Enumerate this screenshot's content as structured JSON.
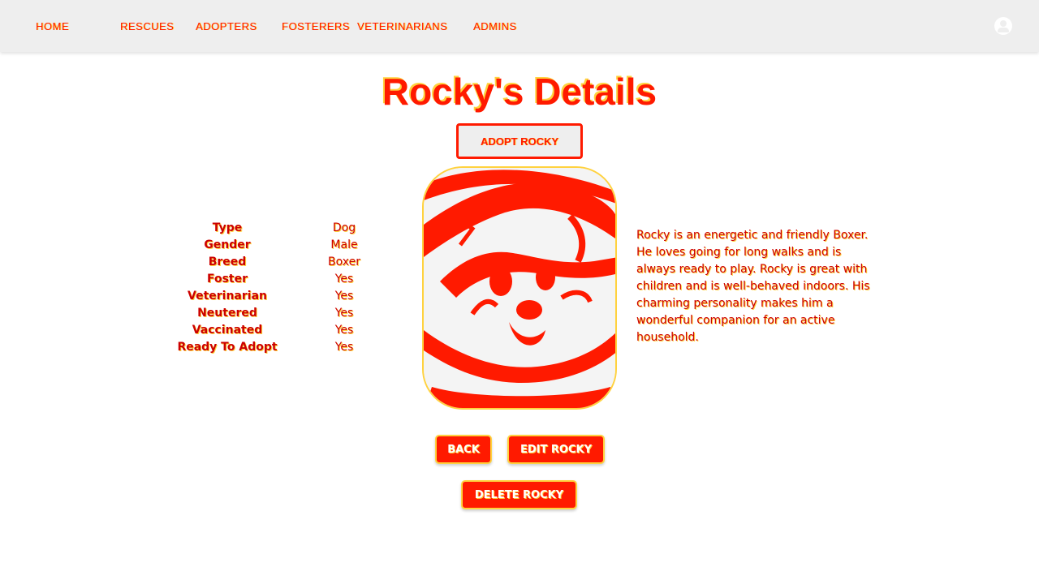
{
  "nav": {
    "home": "HOME",
    "rescues": "RESCUES",
    "adopters": "ADOPTERS",
    "fosterers": "FOSTERERS",
    "vets": "VETERINARIANS",
    "admins": "ADMINS",
    "user_icon": "account-circle-icon"
  },
  "page": {
    "title": "Rocky's Details",
    "adopt_button": "ADOPT ROCKY"
  },
  "details": [
    {
      "label": "Type",
      "value": "Dog"
    },
    {
      "label": "Gender",
      "value": "Male"
    },
    {
      "label": "Breed",
      "value": "Boxer"
    },
    {
      "label": "Foster",
      "value": "Yes"
    },
    {
      "label": "Veterinarian",
      "value": "Yes"
    },
    {
      "label": "Neutered",
      "value": "Yes"
    },
    {
      "label": "Vaccinated",
      "value": "Yes"
    },
    {
      "label": "Ready To Adopt",
      "value": "Yes"
    }
  ],
  "description": "Rocky is an energetic and friendly Boxer. He loves going for long walks and is always ready to play. Rocky is great with children and is well-behaved indoors. His charming personality makes him a wonderful companion for an active household.",
  "actions": {
    "back": "BACK",
    "edit": "EDIT ROCKY",
    "delete": "DELETE ROCKY"
  },
  "colors": {
    "accent": "#ff1a00",
    "highlight": "#ffd23f",
    "navbar": "#eeeeee"
  }
}
